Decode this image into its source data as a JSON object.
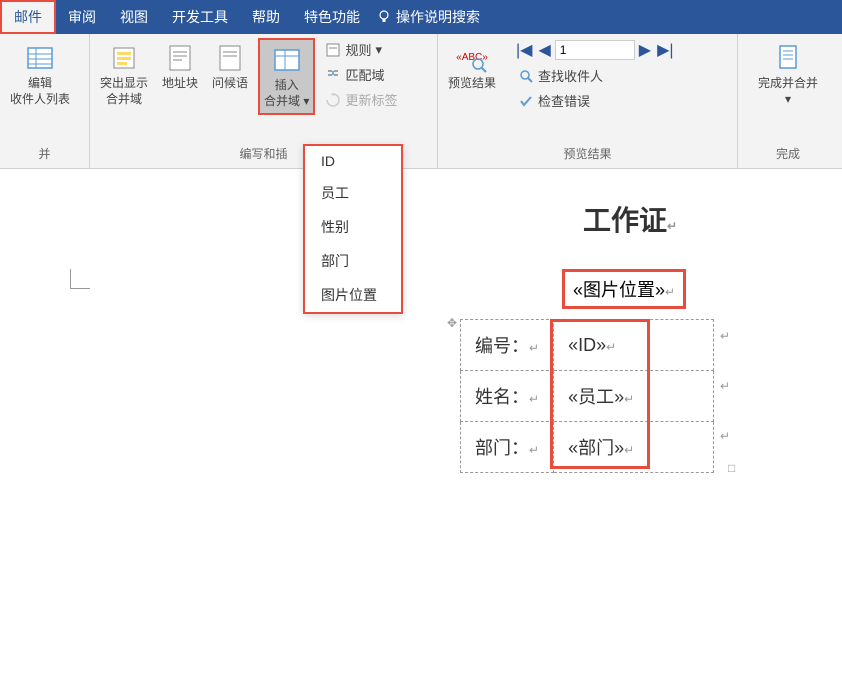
{
  "tabs": {
    "mail": "邮件",
    "review": "审阅",
    "view": "视图",
    "devtools": "开发工具",
    "help": "帮助",
    "special": "特色功能",
    "search": "操作说明搜索"
  },
  "ribbon": {
    "edit_recipients": "编辑\n收件人列表",
    "edit_recipients_group_suffix": "并",
    "highlight_fields": "突出显示\n合并域",
    "address_block": "地址块",
    "greeting": "问候语",
    "insert_merge": "插入\n合并域",
    "rules": "规则",
    "match_fields": "匹配域",
    "update_labels": "更新标签",
    "write_group": "编写和插",
    "preview_results": "预览结果",
    "find_recipient": "查找收件人",
    "check_errors": "检查错误",
    "preview_group": "预览结果",
    "finish_merge": "完成并合并",
    "finish_group": "完成",
    "nav_value": "1"
  },
  "dropdown": {
    "items": [
      "ID",
      "员工",
      "性别",
      "部门",
      "图片位置"
    ]
  },
  "document": {
    "title": "工作证",
    "photo_field": "«图片位置»",
    "rows": [
      {
        "label": "编号：",
        "value": "«ID»"
      },
      {
        "label": "姓名：",
        "value": "«员工»"
      },
      {
        "label": "部门：",
        "value": "«部门»"
      }
    ]
  }
}
